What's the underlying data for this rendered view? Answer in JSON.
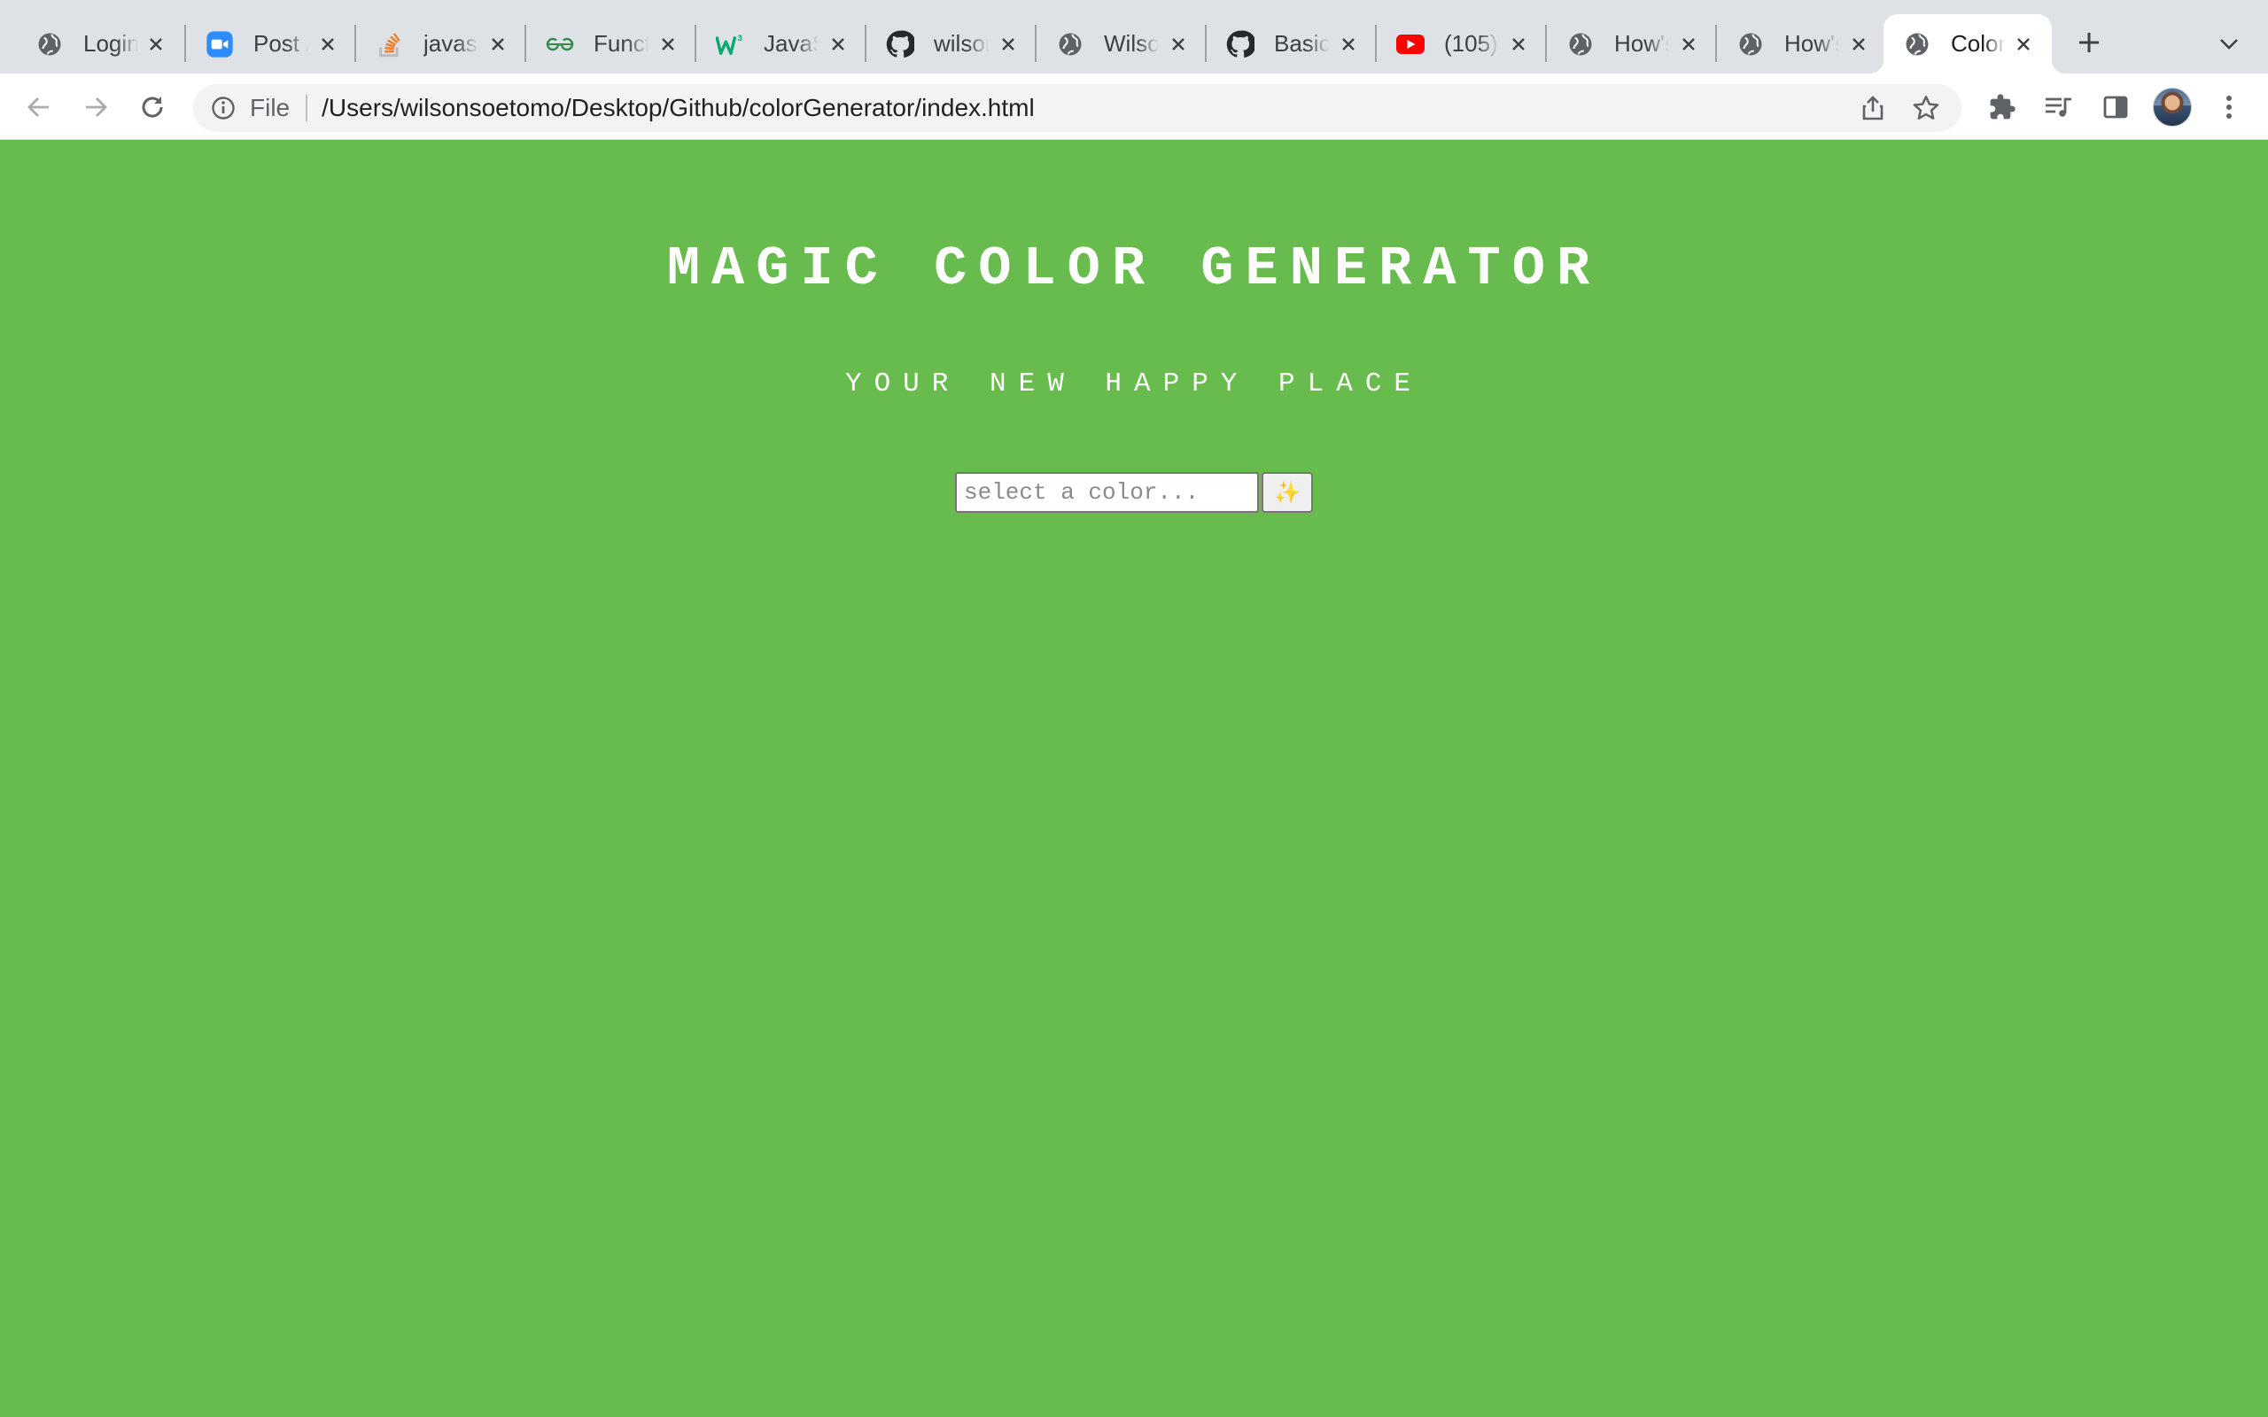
{
  "browser": {
    "tabs": [
      {
        "title": "Login",
        "icon": "globe-icon"
      },
      {
        "title": "Post /",
        "icon": "zoom-icon"
      },
      {
        "title": "javasc",
        "icon": "stackoverflow-icon"
      },
      {
        "title": "Funct",
        "icon": "geeksforgeeks-icon"
      },
      {
        "title": "JavaS",
        "icon": "w3schools-icon"
      },
      {
        "title": "wilson",
        "icon": "github-icon"
      },
      {
        "title": "Wilso",
        "icon": "globe-icon"
      },
      {
        "title": "Basic",
        "icon": "github-icon"
      },
      {
        "title": "(105)",
        "icon": "youtube-icon"
      },
      {
        "title": "How's",
        "icon": "globe-icon"
      },
      {
        "title": "How's",
        "icon": "globe-icon"
      },
      {
        "title": "Color",
        "icon": "globe-icon",
        "active": true
      }
    ],
    "address": {
      "scheme_label": "File",
      "url": "/Users/wilsonsoetomo/Desktop/Github/colorGenerator/index.html"
    }
  },
  "page": {
    "title": "MAGIC COLOR GENERATOR",
    "subtitle": "YOUR NEW HAPPY PLACE",
    "color_input": {
      "placeholder": "select a color...",
      "value": ""
    },
    "generate_button": {
      "label": "✨"
    },
    "background_color": "#68bc4e"
  },
  "colors": {
    "page_background": "#68bc4e",
    "tabstrip": "#dee1e6",
    "omnibox": "#f1f3f4"
  }
}
